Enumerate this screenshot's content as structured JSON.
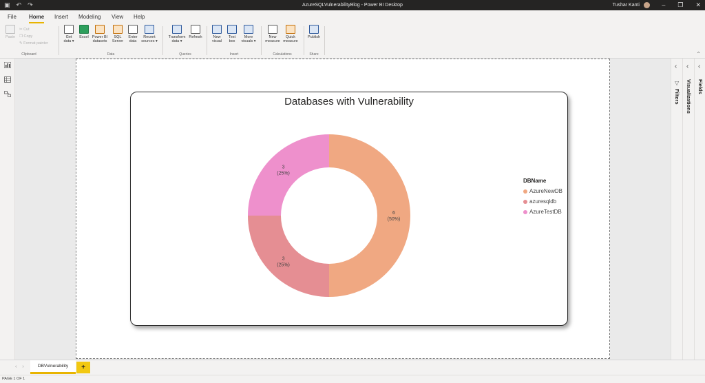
{
  "window": {
    "title": "AzureSQLVulnerabilityBlog - Power BI Desktop",
    "user_name": "Tushar Kanti"
  },
  "menu": {
    "tabs": [
      "File",
      "Home",
      "Insert",
      "Modeling",
      "View",
      "Help"
    ],
    "active": "Home"
  },
  "ribbon": {
    "clipboard": {
      "paste": "Paste",
      "cut": "Cut",
      "copy": "Copy",
      "format_painter": "Format painter",
      "label": "Clipboard"
    },
    "data": {
      "get_data": [
        "Get",
        "data ▾"
      ],
      "excel": "Excel",
      "power_bi_datasets": [
        "Power BI",
        "datasets"
      ],
      "sql_server": [
        "SQL",
        "Server"
      ],
      "enter_data": [
        "Enter",
        "data"
      ],
      "recent_sources": [
        "Recent",
        "sources ▾"
      ],
      "label": "Data"
    },
    "queries": {
      "transform_data": [
        "Transform",
        "data ▾"
      ],
      "refresh": "Refresh",
      "label": "Queries"
    },
    "insert": {
      "new_visual": [
        "New",
        "visual"
      ],
      "text_box": [
        "Text",
        "box"
      ],
      "more_visuals": [
        "More",
        "visuals ▾"
      ],
      "label": "Insert"
    },
    "calculations": {
      "new_measure": [
        "New",
        "measure"
      ],
      "quick_measure": [
        "Quick",
        "measure"
      ],
      "label": "Calculations"
    },
    "share": {
      "publish": "Publish",
      "label": "Share"
    }
  },
  "visual": {
    "title": "Databases with Vulnerability",
    "legend_title": "DBName"
  },
  "chart_data": {
    "type": "pie",
    "title": "Databases with Vulnerability",
    "legend_title": "DBName",
    "legend_position": "right",
    "donut": true,
    "slices": [
      {
        "name": "AzureNewDB",
        "value": 6,
        "label": "6",
        "pct_label": "(50%)",
        "color": "#f0a882"
      },
      {
        "name": "azuresqldb",
        "value": 3,
        "label": "3",
        "pct_label": "(25%)",
        "color": "#e58e93"
      },
      {
        "name": "AzureTestDB",
        "value": 3,
        "label": "3",
        "pct_label": "(25%)",
        "color": "#ee90cc"
      }
    ]
  },
  "panes": {
    "filters": "Filters",
    "visualizations": "Visualizations",
    "fields": "Fields"
  },
  "page_tabs": {
    "items": [
      "DBVulnerability"
    ],
    "add_label": "+"
  },
  "status": {
    "page_indicator": "PAGE 1 OF 1"
  },
  "colors": {
    "accent": "#f2c811",
    "titlebar": "#252423"
  }
}
